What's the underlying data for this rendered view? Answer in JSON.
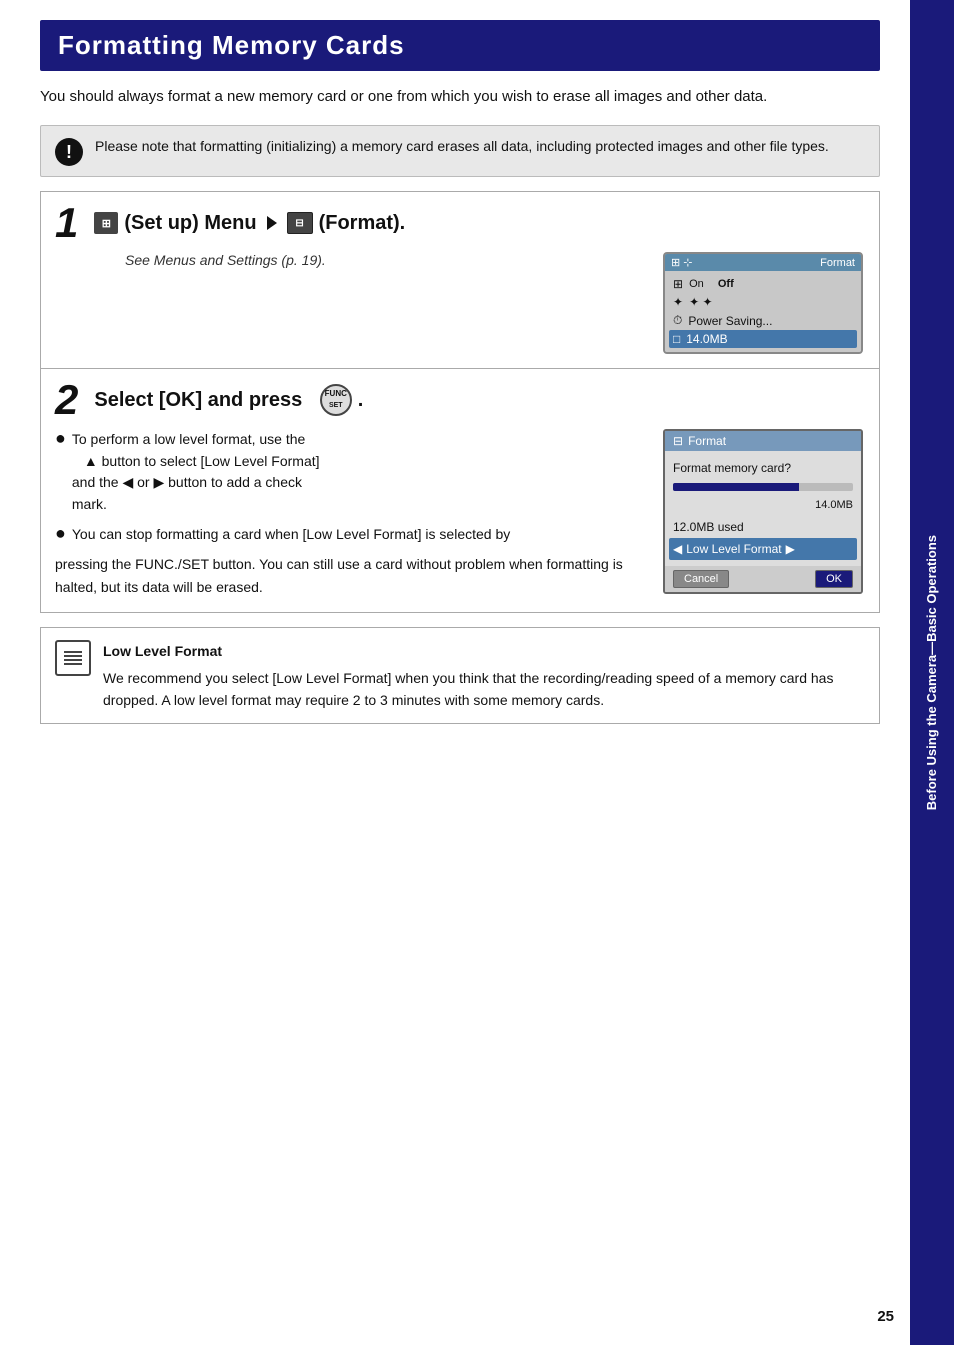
{
  "page": {
    "title": "Formatting Memory Cards",
    "page_number": "25",
    "sidebar_label": "Before Using the Camera—Basic Operations"
  },
  "intro": {
    "text": "You should always format a new memory card or one from which you wish to erase all images and other data."
  },
  "warning": {
    "text": "Please note that formatting (initializing) a memory card erases all data, including protected images and other file types."
  },
  "step1": {
    "number": "1",
    "title_text": "(Set up) Menu",
    "arrow": "▶",
    "title_suffix": "(Format).",
    "see_also": "See Menus and Settings (p. 19).",
    "screen": {
      "header_icon": "⊞",
      "header_label": "Format",
      "rows": [
        {
          "icon": "⊞",
          "label": "On  Off",
          "highlight": false
        },
        {
          "icon": "✦",
          "label": "✦ ✦",
          "highlight": false
        },
        {
          "icon": "⏱",
          "label": "Power Saving...",
          "highlight": false
        },
        {
          "icon": "⊡",
          "label": "14.0MB",
          "highlight": true
        }
      ]
    }
  },
  "step2": {
    "number": "2",
    "title": "Select [OK] and press",
    "func_set_label": "FUNC\nSET",
    "bullets": [
      {
        "main": "To perform a low level format, use the",
        "sub": "▲ button to select [Low Level Format] and the ◀ or ▶ button to add a check mark."
      }
    ],
    "bullet2": "You can stop formatting a card when [Low Level Format] is selected by pressing the FUNC./SET button. You can still use a card without problem when formatting is halted, but its data will be erased.",
    "dialog": {
      "header_icon": "⊞",
      "header_label": "Format",
      "line1": "Format memory card?",
      "progress_label": "14.0MB",
      "line2": "12.0MB used",
      "low_level": "◀  ▶ Low Level Format",
      "cancel_label": "Cancel",
      "ok_label": "OK"
    }
  },
  "note": {
    "title": "Low Level Format",
    "body": "We recommend you select [Low Level Format] when you think that the recording/reading speed of a memory card has dropped. A low level format may require 2 to 3 minutes with some memory cards."
  }
}
